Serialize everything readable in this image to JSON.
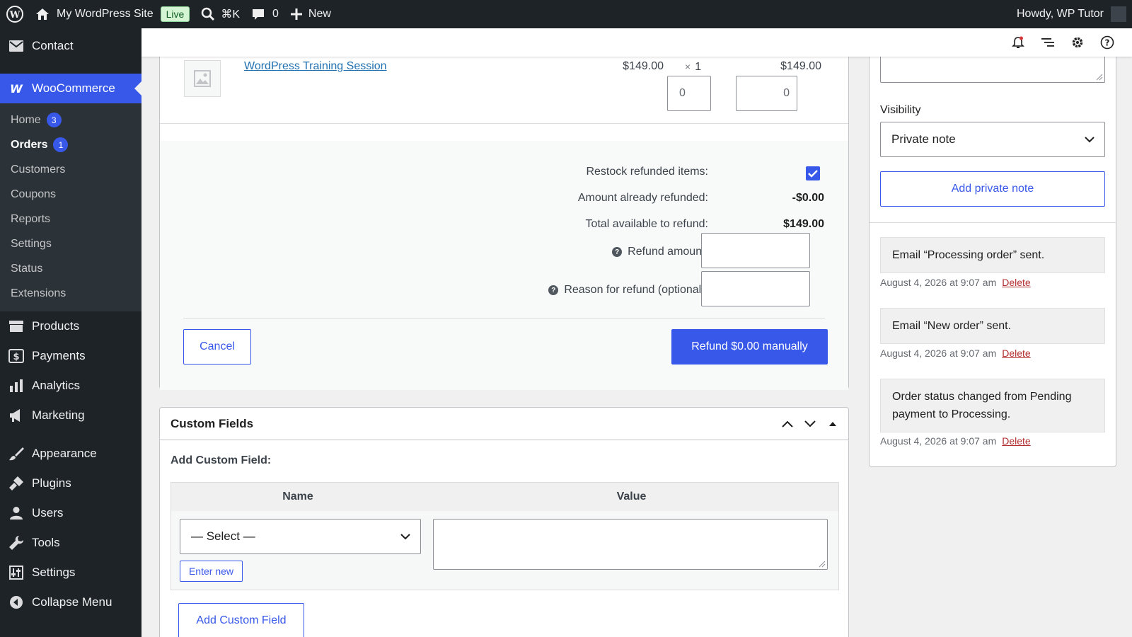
{
  "adminbar": {
    "site_name": "My WordPress Site",
    "live_badge": "Live",
    "search_shortcut": "⌘K",
    "comments_count": "0",
    "new_label": "New",
    "howdy": "Howdy, WP Tutor"
  },
  "sidebar": {
    "contact": "Contact",
    "woocommerce": "WooCommerce",
    "sub": [
      {
        "label": "Home",
        "count": "3"
      },
      {
        "label": "Orders",
        "count": "1"
      },
      {
        "label": "Customers"
      },
      {
        "label": "Coupons"
      },
      {
        "label": "Reports"
      },
      {
        "label": "Settings"
      },
      {
        "label": "Status"
      },
      {
        "label": "Extensions"
      }
    ],
    "items": [
      "Products",
      "Payments",
      "Analytics",
      "Marketing",
      "Appearance",
      "Plugins",
      "Users",
      "Tools",
      "Settings",
      "Collapse Menu"
    ]
  },
  "order_item": {
    "name": "WordPress Training Session",
    "price": "$149.00",
    "qty_symbol": "×",
    "qty": "1",
    "total": "$149.00",
    "refund_qty": "0",
    "refund_total": "0"
  },
  "refund": {
    "restock_label": "Restock refunded items:",
    "already_refunded_label": "Amount already refunded:",
    "already_refunded_value": "-$0.00",
    "available_label": "Total available to refund:",
    "available_value": "$149.00",
    "amount_label": "Refund amount:",
    "reason_label": "Reason for refund (optional):",
    "cancel": "Cancel",
    "refund_button": "Refund $0.00 manually",
    "restock_checked": true
  },
  "custom_fields": {
    "title": "Custom Fields",
    "add_label": "Add Custom Field:",
    "col_name": "Name",
    "col_value": "Value",
    "select_value": "— Select —",
    "enter_new": "Enter new",
    "add_button": "Add Custom Field"
  },
  "notes": {
    "visibility_label": "Visibility",
    "visibility_value": "Private note",
    "add_button": "Add private note",
    "entries": [
      {
        "text": "Email “Processing order” sent.",
        "date": "August 4, 2026 at 9:07 am",
        "delete": "Delete"
      },
      {
        "text": "Email “New order” sent.",
        "date": "August 4, 2026 at 9:07 am",
        "delete": "Delete"
      },
      {
        "text": "Order status changed from Pending payment to Processing.",
        "date": "August 4, 2026 at 9:07 am",
        "delete": "Delete"
      }
    ]
  },
  "colors": {
    "accent": "#3858e9",
    "admin_dark": "#1d2327",
    "delete_red": "#b32d2e"
  }
}
